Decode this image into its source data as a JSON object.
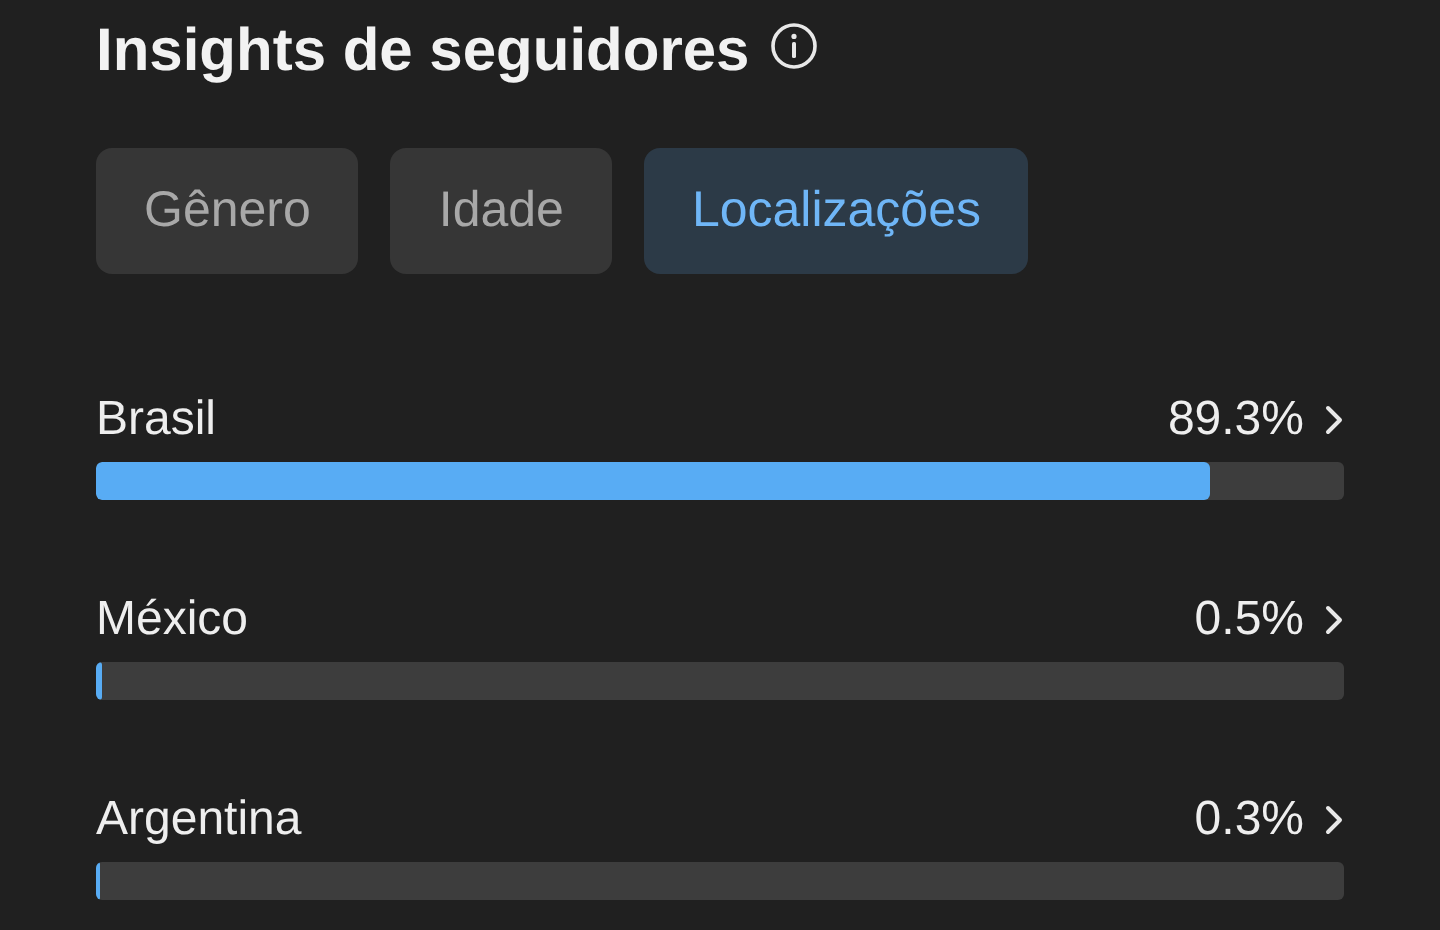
{
  "title": "Insights de seguidores",
  "tabs": [
    {
      "label": "Gênero",
      "selected": false
    },
    {
      "label": "Idade",
      "selected": false
    },
    {
      "label": "Localizações",
      "selected": true
    }
  ],
  "locations": [
    {
      "name": "Brasil",
      "reading": "89.3%",
      "level": 0.893
    },
    {
      "name": "México",
      "reading": "0.5%",
      "level": 0.005
    },
    {
      "name": "Argentina",
      "reading": "0.3%",
      "level": 0.003
    }
  ]
}
